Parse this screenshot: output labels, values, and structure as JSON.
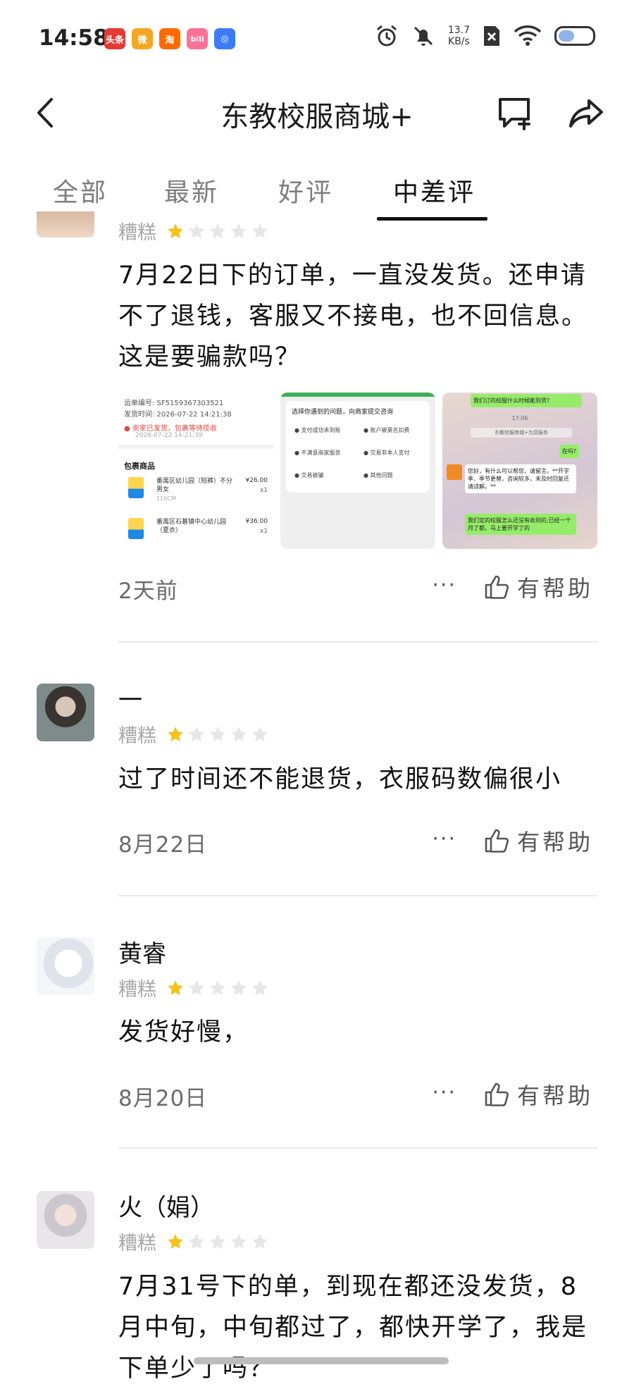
{
  "status_bar": {
    "time": "14:58",
    "net_speed_value": "13.7",
    "net_speed_unit": "KB/s",
    "apps": [
      {
        "icon": "toutiao-icon",
        "label": "头条",
        "color": "#e53935"
      },
      {
        "icon": "weibo-icon",
        "label": "微",
        "color": "#f5a623"
      },
      {
        "icon": "taobao-icon",
        "label": "淘",
        "color": "#ff6a00"
      },
      {
        "icon": "bilibili-icon",
        "label": "bili",
        "color": "#fb7299"
      },
      {
        "icon": "browser-icon",
        "label": "◎",
        "color": "#3b7cf6"
      }
    ]
  },
  "header": {
    "title": "东教校服商城+"
  },
  "tabs": [
    {
      "label": "全部",
      "active": false
    },
    {
      "label": "最新",
      "active": false
    },
    {
      "label": "好评",
      "active": false
    },
    {
      "label": "中差评",
      "active": true
    }
  ],
  "reviews": [
    {
      "name": "",
      "rating_label": "糟糕",
      "stars": 1,
      "content": "7月22日下的订单，一直没发货。还申请不了退钱，客服又不接电，也不回信息。这是要骗款吗？",
      "date": "2天前",
      "helpful_label": "有帮助",
      "images": {
        "order": {
          "waybill": "运单编号: SF5159367303521",
          "ship_time": "发货时间: 2026-07-22 14:21:38",
          "status": "卖家已发货，包裹等待揽收",
          "status_time": "2026-07-22 14:21:39",
          "section": "包裹商品",
          "items": [
            {
              "name": "番禺区幼儿园（短裤）不分男女",
              "size": "110CM",
              "price": "¥26.00",
              "qty": "x1"
            },
            {
              "name": "番禺区石碁镇中心幼儿园（夏衣）",
              "size": "",
              "price": "¥36.00",
              "qty": "x1"
            }
          ]
        },
        "issue": {
          "heading": "选择你遇到的问题，向商家提交咨询",
          "options": [
            "支付成功未到账",
            "账户被莫名扣费",
            "不满意商家服务",
            "交易非本人支付",
            "交易被骗",
            "其他问题"
          ]
        },
        "chat": {
          "msg1": "我们订的校服什么时候能到货?",
          "time": "17:06",
          "system": "东教校服商城+为您服务",
          "msg2": "在吗?",
          "reply": "您好，有什么可以帮您，请留言。**开学季、季节更替，咨询较多，未及时回复还请谅解。**",
          "msg3": "我们定的校服怎么还没有收到的,已经一个月了都，马上要开学了的"
        }
      }
    },
    {
      "name": "一",
      "rating_label": "糟糕",
      "stars": 1,
      "content": "过了时间还不能退货，衣服码数偏很小",
      "date": "8月22日",
      "helpful_label": "有帮助"
    },
    {
      "name": "黄睿",
      "rating_label": "糟糕",
      "stars": 1,
      "content": "发货好慢，",
      "date": "8月20日",
      "helpful_label": "有帮助"
    },
    {
      "name": "火（娟）",
      "rating_label": "糟糕",
      "stars": 1,
      "content": "7月31号下的单，到现在都还没发货，8月中旬，中旬都过了，都快开学了，我是下单少了吗？"
    }
  ],
  "colors": {
    "star_on": "#f6c21c",
    "star_off": "#e6e6e6",
    "chat_green": "#95ec69"
  }
}
